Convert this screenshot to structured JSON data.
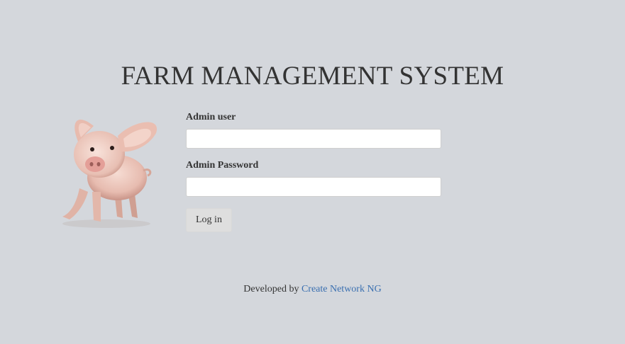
{
  "header": {
    "title": "FARM MANAGEMENT SYSTEM"
  },
  "image": {
    "icon": "pig-image"
  },
  "login_form": {
    "user_label": "Admin user",
    "user_value": "",
    "password_label": "Admin Password",
    "password_value": "",
    "submit_label": "Log in"
  },
  "footer": {
    "prefix": "Developed by",
    "link_text": "Create Network NG"
  },
  "colors": {
    "background": "#d4d7dc",
    "link": "#3a6fb0",
    "button": "#dedede"
  }
}
